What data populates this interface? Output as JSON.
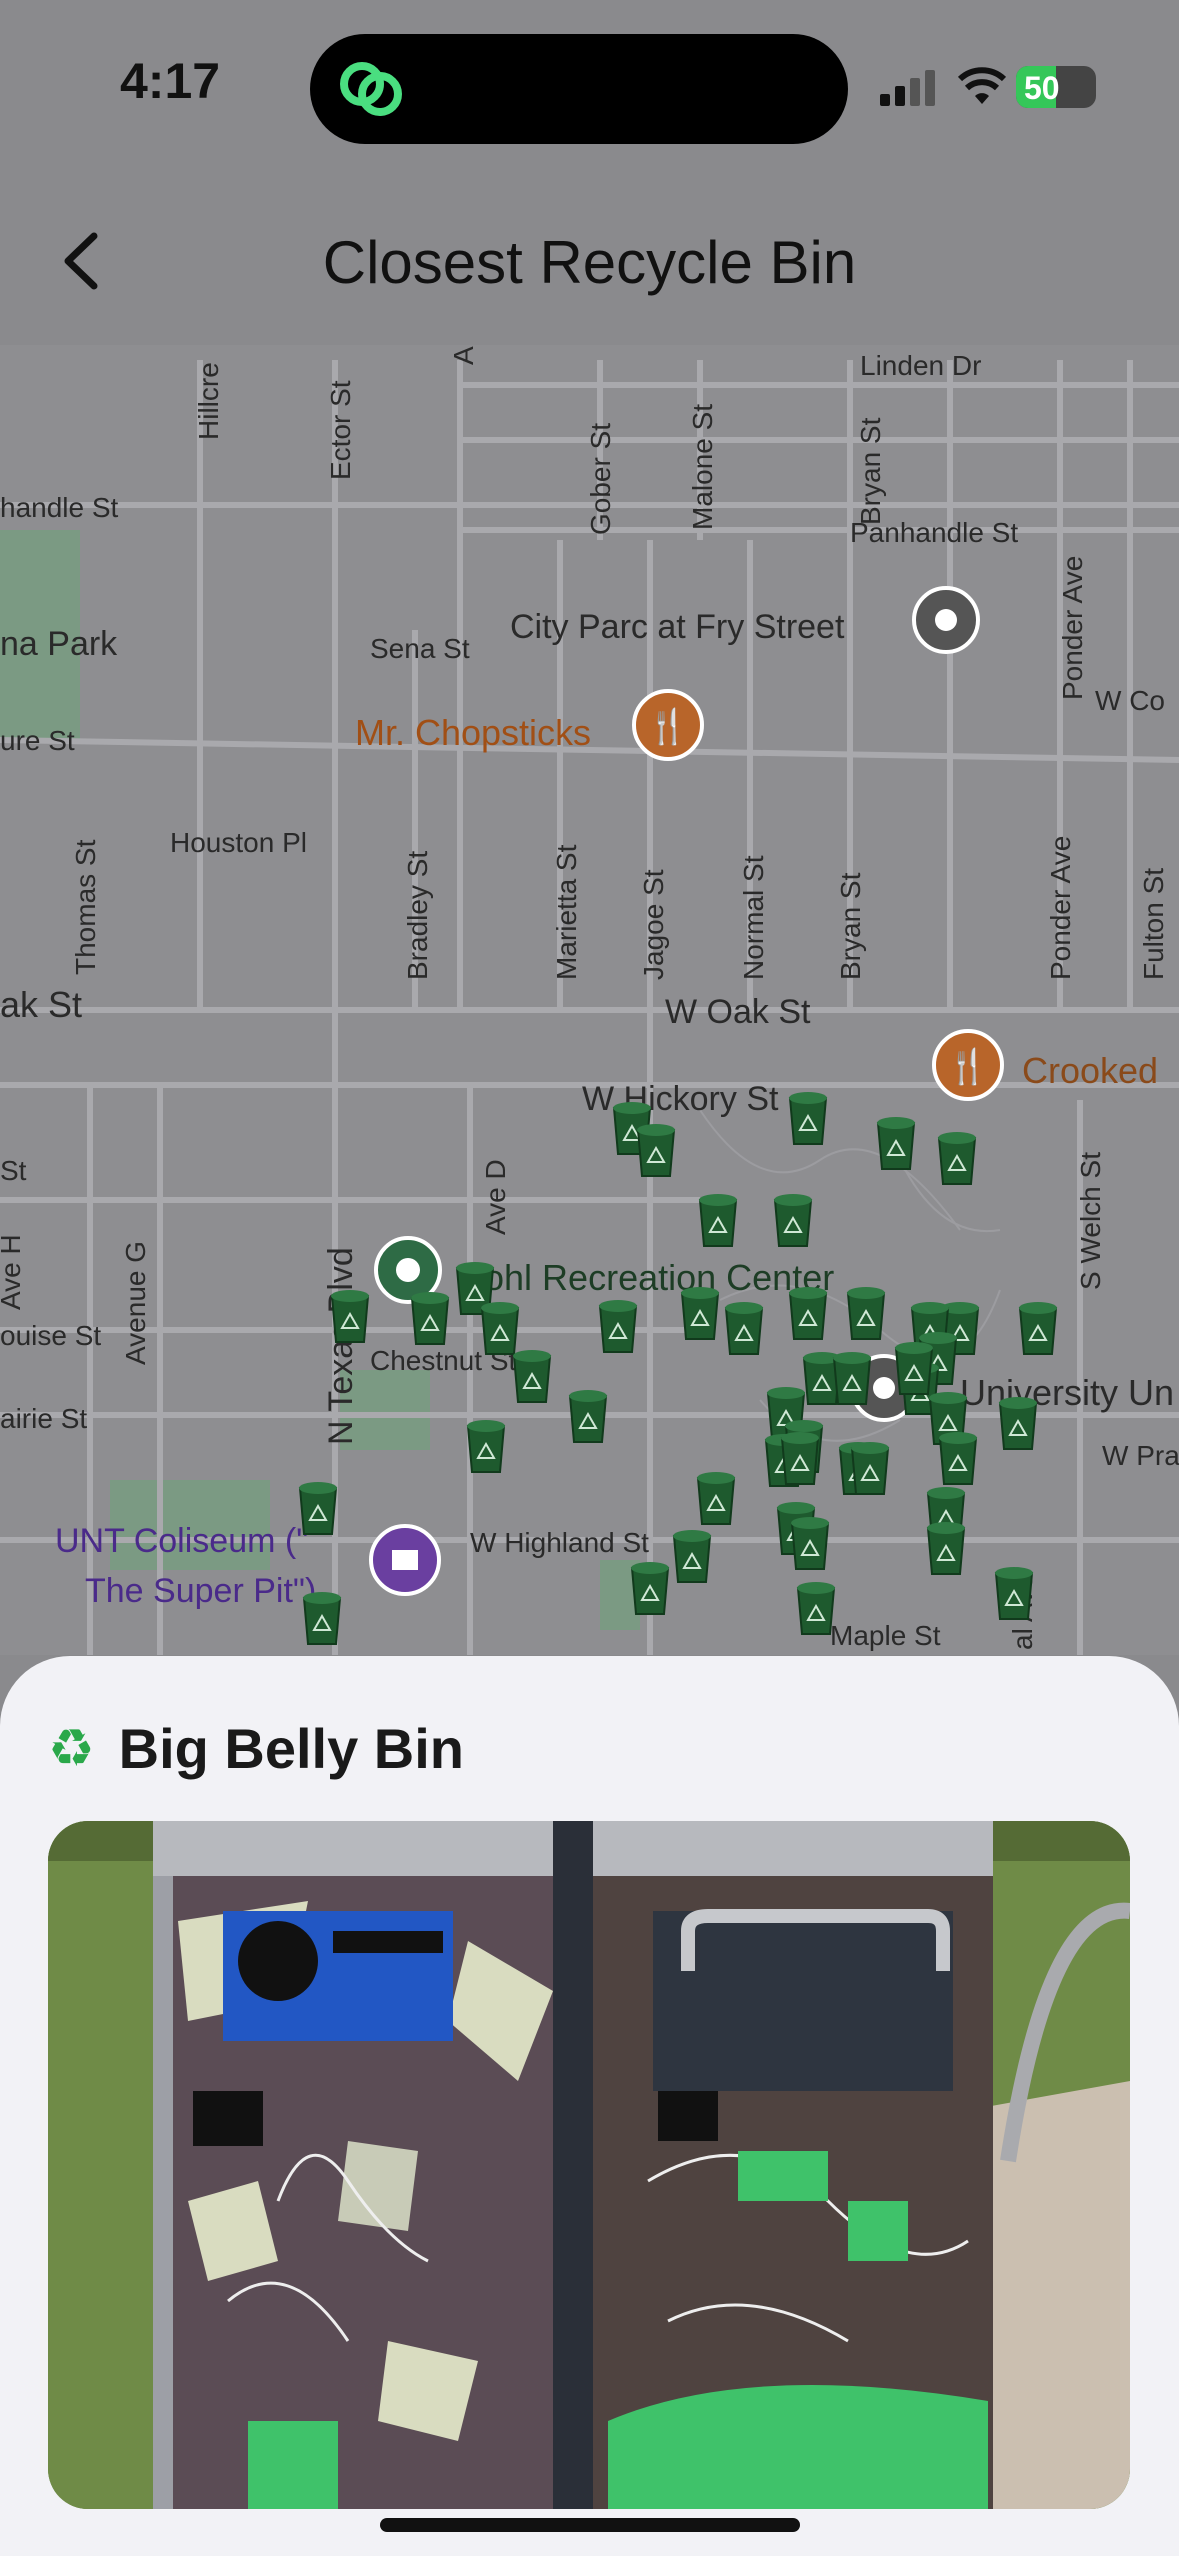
{
  "status_bar": {
    "time": "4:17",
    "battery": "50",
    "battery_level_percent": 50
  },
  "nav": {
    "title": "Closest Recycle Bin"
  },
  "map": {
    "streets": [
      "Linden Dr",
      "Hillcre",
      "Ector St",
      "A",
      "Gober St",
      "Malone St",
      "Bryan St",
      "Panhandle St",
      "handle St",
      "na Park",
      "Sena St",
      "City Parc at Fry Street",
      "Ponder Ave",
      "W Co",
      "ure St",
      "Houston Pl",
      "Thomas St",
      "Bradley St",
      "Marietta St",
      "Jagoe St",
      "Normal St",
      "Bryan St",
      "Ponder Ave",
      "Fulton St",
      "ak St",
      "W Oak St",
      "W Hickory St",
      "Crooked",
      "Ave D",
      "N Texas Blvd",
      "Avenue G",
      "Ave H",
      "S Welch St",
      "Chestnut St",
      "ouise St",
      "airie St",
      "University Un",
      "W Pra",
      "UNT Coliseum (\"",
      "The Super Pit\")",
      "W Highland St",
      "Maple St",
      "al Ave",
      "St"
    ],
    "pois": [
      "Mr. Chopsticks",
      "Pohl Recreation Center"
    ]
  },
  "sheet": {
    "title": "Big Belly Bin",
    "icon": "recycle-icon"
  },
  "colors": {
    "bin_green": "#1e5a2e",
    "poi_orange": "#b8652a",
    "poi_purple": "#6a3fa0"
  }
}
